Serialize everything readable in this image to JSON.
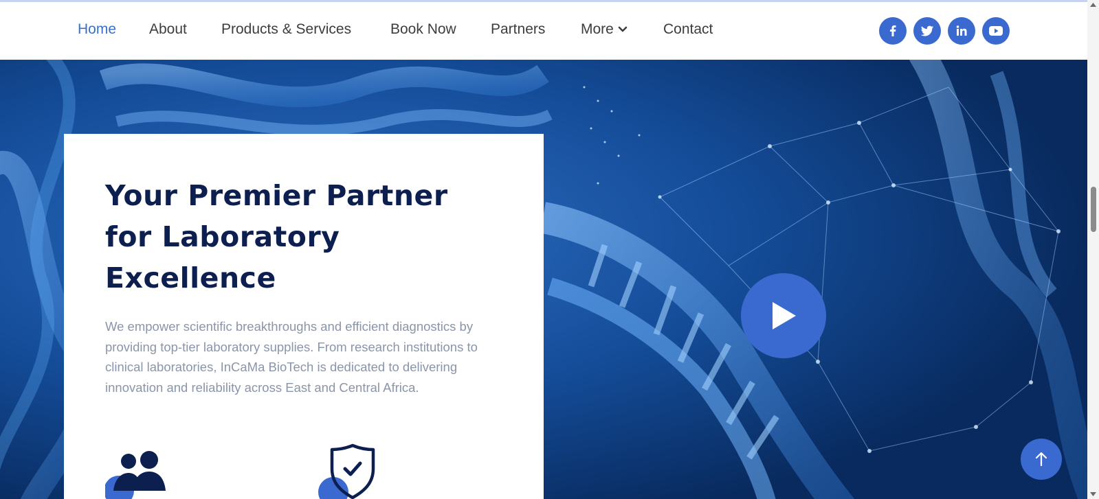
{
  "nav": {
    "items": [
      {
        "label": "Home",
        "active": true
      },
      {
        "label": "About"
      },
      {
        "label": "Products & Services"
      },
      {
        "label": "Book Now"
      },
      {
        "label": "Partners"
      },
      {
        "label": "More",
        "has_dropdown": true
      },
      {
        "label": "Contact"
      }
    ],
    "social": [
      "facebook-icon",
      "twitter-icon",
      "linkedin-icon",
      "youtube-icon"
    ]
  },
  "hero": {
    "headline": "Your Premier Partner for Laboratory Excellence",
    "description": "We empower scientific breakthroughs and efficient diagnostics by providing top-tier laboratory supplies. From research institutions to clinical laboratories, InCaMa BioTech is dedicated to delivering innovation and reliability across East and Central Africa.",
    "features": [
      "users-icon",
      "shield-check-icon"
    ],
    "play_icon": "play-icon"
  },
  "scroll_to_top_icon": "arrow-up-icon",
  "colors": {
    "accent": "#3a6ad0",
    "nav_active": "#3a6fc9",
    "headline": "#0d1f4f",
    "body_text": "#8a95a8",
    "hero_bg": "#0b3a7a"
  }
}
